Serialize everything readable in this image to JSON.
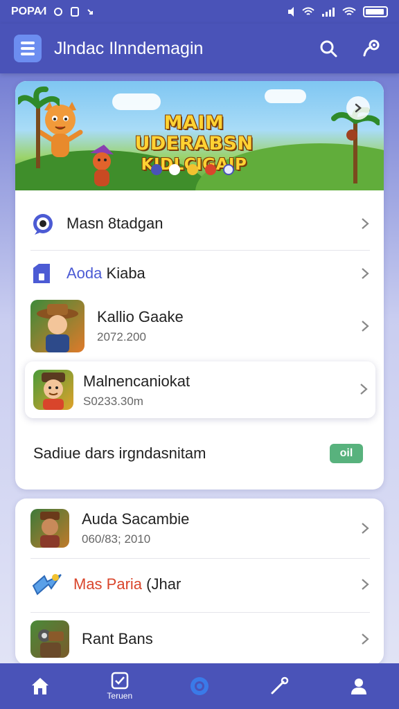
{
  "status_bar": {
    "left_text": "POPA⁄I",
    "icons": [
      "alarm-icon",
      "sim-icon",
      "arrow-icon",
      "volume-icon",
      "wifi-icon",
      "signal-icon",
      "battery-icon"
    ]
  },
  "app_bar": {
    "title": "Jlndac Ilnndemagin",
    "icons": [
      "menu-icon",
      "search-icon",
      "settings-icon"
    ]
  },
  "banner": {
    "title_line1": "MAIM UDERABSN",
    "title_line2": "KIDLCIGAIP"
  },
  "list1": {
    "item1_label": "Masn 8tadgan",
    "item2_label_a": "Aoda",
    "item2_label_b": "Kiaba",
    "item3_label": "Kallio Gaake",
    "item3_sub": "2072.200",
    "item4_label": "Malnencaniokat",
    "item4_sub": "S0233.30m",
    "toggle_row_label": "Sadiue dars irgndasnitam",
    "toggle_text": "oil"
  },
  "list2": {
    "item1_label": "Auda Sacambie",
    "item1_sub": "060/83; 2010",
    "item2_label_a": "Mas Paria",
    "item2_label_b": "(Jhar",
    "item3_label": "Rant Bans"
  },
  "bottom_nav": {
    "item2_label": "Teruen"
  },
  "colors": {
    "primary": "#4a53b8",
    "accent_green": "#58b27d",
    "accent_red": "#d9452b",
    "accent_blue": "#4c5bd4"
  }
}
